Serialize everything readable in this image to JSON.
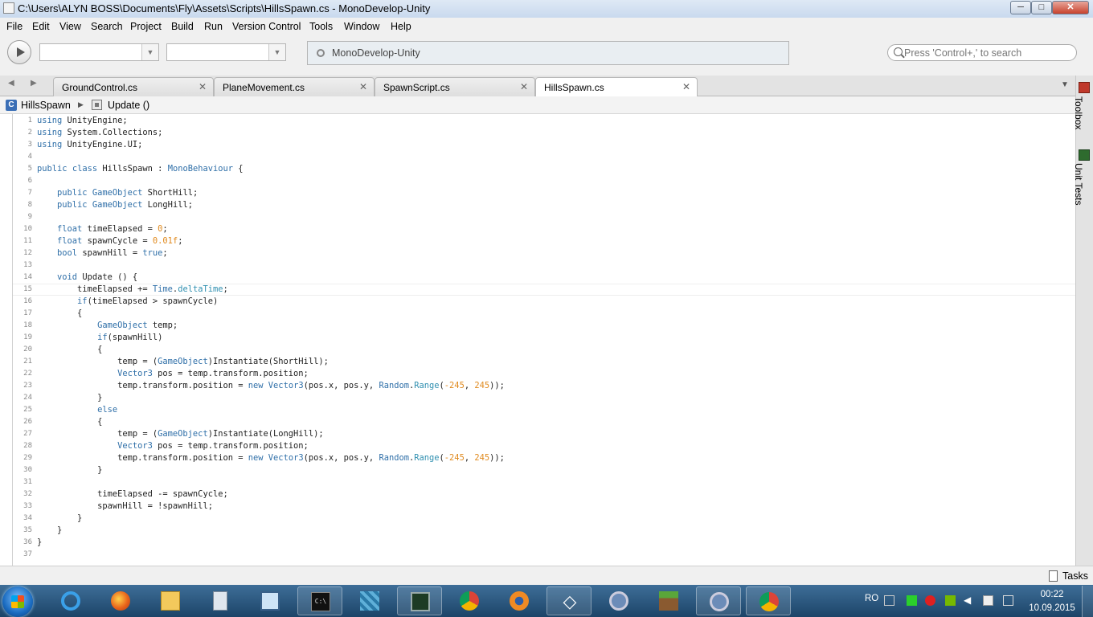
{
  "window": {
    "title": "C:\\Users\\ALYN BOSS\\Documents\\Fly\\Assets\\Scripts\\HillsSpawn.cs - MonoDevelop-Unity",
    "minimize": "─",
    "maximize": "□",
    "close": "✕"
  },
  "menu": [
    "File",
    "Edit",
    "View",
    "Search",
    "Project",
    "Build",
    "Run",
    "Version Control",
    "Tools",
    "Window",
    "Help"
  ],
  "toolbar": {
    "config_value": "",
    "platform_value": "",
    "status_text": "MonoDevelop-Unity",
    "search_placeholder": "Press 'Control+,' to search"
  },
  "tabs": [
    {
      "label": "GroundControl.cs",
      "active": false
    },
    {
      "label": "PlaneMovement.cs",
      "active": false
    },
    {
      "label": "SpawnScript.cs",
      "active": false
    },
    {
      "label": "HillsSpawn.cs",
      "active": true
    }
  ],
  "breadcrumb": {
    "class_icon": "C",
    "class_name": "HillsSpawn",
    "method_name": "Update ()"
  },
  "editor": {
    "current_line": 15,
    "lines": [
      "using UnityEngine;",
      "using System.Collections;",
      "using UnityEngine.UI;",
      "",
      "public class HillsSpawn : MonoBehaviour {",
      "",
      "    public GameObject ShortHill;",
      "    public GameObject LongHill;",
      "",
      "    float timeElapsed = 0;",
      "    float spawnCycle = 0.01f;",
      "    bool spawnHill = true;",
      "",
      "    void Update () {",
      "        timeElapsed += Time.deltaTime;",
      "        if(timeElapsed > spawnCycle)",
      "        {",
      "            GameObject temp;",
      "            if(spawnHill)",
      "            {",
      "                temp = (GameObject)Instantiate(ShortHill);",
      "                Vector3 pos = temp.transform.position;",
      "                temp.transform.position = new Vector3(pos.x, pos.y, Random.Range(-245, 245));",
      "            }",
      "            else",
      "            {",
      "                temp = (GameObject)Instantiate(LongHill);",
      "                Vector3 pos = temp.transform.position;",
      "                temp.transform.position = new Vector3(pos.x, pos.y, Random.Range(-245, 245));",
      "            }",
      "",
      "            timeElapsed -= spawnCycle;",
      "            spawnHill = !spawnHill;",
      "        }",
      "    }",
      "}",
      ""
    ]
  },
  "side_pads": [
    "Toolbox",
    "Unit Tests"
  ],
  "bottom": {
    "tasks_label": "Tasks"
  },
  "taskbar": {
    "apps": [
      "internet-explorer",
      "firefox",
      "file-explorer",
      "calculator",
      "monitor-tool",
      "command-prompt",
      "cube-app",
      "terminal-app",
      "chrome",
      "blender",
      "unity",
      "monodevelop",
      "minecraft",
      "monodevelop-active",
      "chrome-active"
    ],
    "language": "RO",
    "time": "00:22",
    "date": "10.09.2015"
  },
  "colors": {
    "keyword": "#2f6fa8",
    "number": "#e08a1e",
    "member": "#2f8fb0",
    "taskbar": "#2a5a85"
  }
}
